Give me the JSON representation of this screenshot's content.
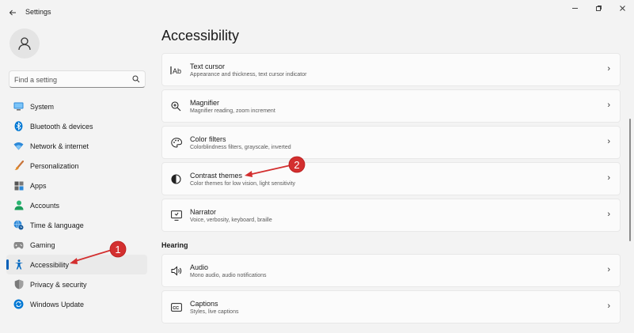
{
  "window": {
    "title": "Settings",
    "controls": [
      "minimize-icon",
      "maximize-icon",
      "close-icon"
    ]
  },
  "search": {
    "placeholder": "Find a setting"
  },
  "sidebar": {
    "items": [
      {
        "label": "System",
        "icon": "monitor-icon",
        "active": false
      },
      {
        "label": "Bluetooth & devices",
        "icon": "bluetooth-icon",
        "active": false
      },
      {
        "label": "Network & internet",
        "icon": "wifi-icon",
        "active": false
      },
      {
        "label": "Personalization",
        "icon": "brush-icon",
        "active": false
      },
      {
        "label": "Apps",
        "icon": "apps-icon",
        "active": false
      },
      {
        "label": "Accounts",
        "icon": "person-icon",
        "active": false
      },
      {
        "label": "Time & language",
        "icon": "globe-clock-icon",
        "active": false
      },
      {
        "label": "Gaming",
        "icon": "controller-icon",
        "active": false
      },
      {
        "label": "Accessibility",
        "icon": "accessibility-icon",
        "active": true
      },
      {
        "label": "Privacy & security",
        "icon": "shield-icon",
        "active": false
      },
      {
        "label": "Windows Update",
        "icon": "update-icon",
        "active": false
      }
    ]
  },
  "main": {
    "title": "Accessibility",
    "vision_items": [
      {
        "title": "Text cursor",
        "subtitle": "Appearance and thickness, text cursor indicator",
        "icon": "text-cursor-icon"
      },
      {
        "title": "Magnifier",
        "subtitle": "Magnifier reading, zoom increment",
        "icon": "magnifier-icon"
      },
      {
        "title": "Color filters",
        "subtitle": "Colorblindness filters, grayscale, inverted",
        "icon": "palette-icon"
      },
      {
        "title": "Contrast themes",
        "subtitle": "Color themes for low vision, light sensitivity",
        "icon": "contrast-icon"
      },
      {
        "title": "Narrator",
        "subtitle": "Voice, verbosity, keyboard, braille",
        "icon": "narrator-icon"
      }
    ],
    "hearing_header": "Hearing",
    "hearing_items": [
      {
        "title": "Audio",
        "subtitle": "Mono audio, audio notifications",
        "icon": "speaker-icon"
      },
      {
        "title": "Captions",
        "subtitle": "Styles, live captions",
        "icon": "captions-icon"
      }
    ]
  },
  "annotations": {
    "marker1": "1",
    "marker2": "2",
    "color": "#d32f2f"
  },
  "colors": {
    "accent": "#005fb8",
    "background": "#f3f3f3",
    "card": "#fbfbfb"
  }
}
